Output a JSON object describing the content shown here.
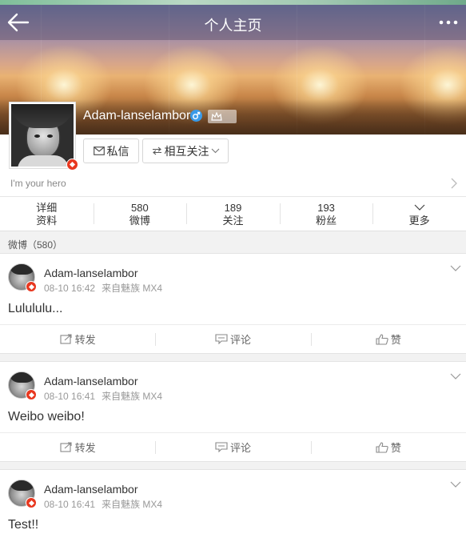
{
  "header": {
    "title": "个人主页",
    "back_icon": "back-arrow-icon",
    "more_icon": "more-dots-icon"
  },
  "profile": {
    "username": "Adam-lanselambor",
    "gender_icon": "male-icon",
    "member_icon": "crown-icon",
    "bio": "I'm your hero",
    "message_label": "私信",
    "follow_label": "相互关注",
    "colors": {
      "verified_badge": "#e8371f",
      "gender": "#3a9be8"
    }
  },
  "stats": [
    {
      "top": "详细",
      "bottom": "资料"
    },
    {
      "top": "580",
      "bottom": "微博"
    },
    {
      "top": "189",
      "bottom": "关注"
    },
    {
      "top": "193",
      "bottom": "粉丝"
    },
    {
      "top": "",
      "bottom": "更多"
    }
  ],
  "feed": {
    "section_label": "微博（580）",
    "actions": {
      "repost": "转发",
      "comment": "评论",
      "like": "赞"
    },
    "posts": [
      {
        "name": "Adam-lanselambor",
        "time": "08-10 16:42",
        "source": "来自魅族 MX4",
        "text": "Lulululu..."
      },
      {
        "name": "Adam-lanselambor",
        "time": "08-10 16:41",
        "source": "来自魅族 MX4",
        "text": "Weibo weibo!"
      },
      {
        "name": "Adam-lanselambor",
        "time": "08-10 16:41",
        "source": "来自魅族 MX4",
        "text": "Test!!"
      }
    ]
  }
}
